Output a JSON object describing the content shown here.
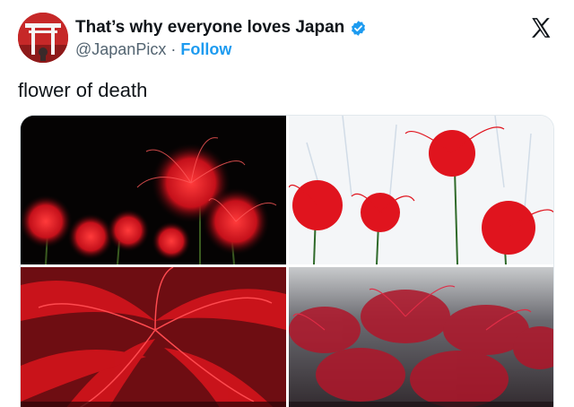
{
  "author": {
    "name": "That’s why everyone loves Japan",
    "handle": "@JapanPicx",
    "separator": "·",
    "follow_label": "Follow",
    "verified": true,
    "verified_color": "#1d9bf0"
  },
  "icons": {
    "avatar": "torii-gate-avatar",
    "verified": "verified-badge-icon",
    "platform": "x-logo-icon"
  },
  "tweet": {
    "text": "flower of death"
  },
  "media": {
    "images": [
      {
        "scene": "red spider lilies on black background"
      },
      {
        "scene": "red spider lilies on white background"
      },
      {
        "scene": "close-up red spider lily petals"
      },
      {
        "scene": "dense field of red spider lilies in mist"
      }
    ]
  },
  "colors": {
    "accent": "#1d9bf0",
    "text": "#0f1419",
    "secondary": "#536471",
    "lily_red": "#e0141e"
  }
}
